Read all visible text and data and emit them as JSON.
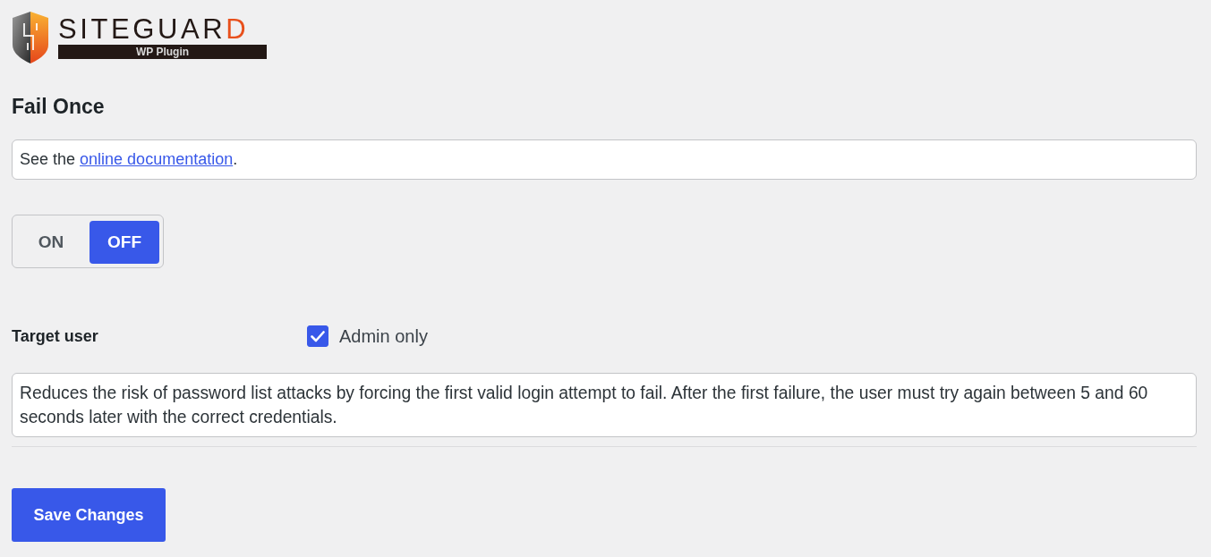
{
  "logo": {
    "brand": "SITEGUARD",
    "tagline": "WP Plugin"
  },
  "title": "Fail Once",
  "doc_note": {
    "before": "See the ",
    "link": "online documentation",
    "after": "."
  },
  "switch": {
    "options": [
      {
        "label": "ON",
        "selected": false
      },
      {
        "label": "OFF",
        "selected": true
      }
    ]
  },
  "target_user": {
    "label": "Target user",
    "option": {
      "label": "Admin only",
      "checked": true
    }
  },
  "description": "Reduces the risk of password list attacks by forcing the first valid login attempt to fail. After the first failure, the user must try again between 5 and 60 seconds later with the correct credentials.",
  "save_button": "Save Changes"
}
